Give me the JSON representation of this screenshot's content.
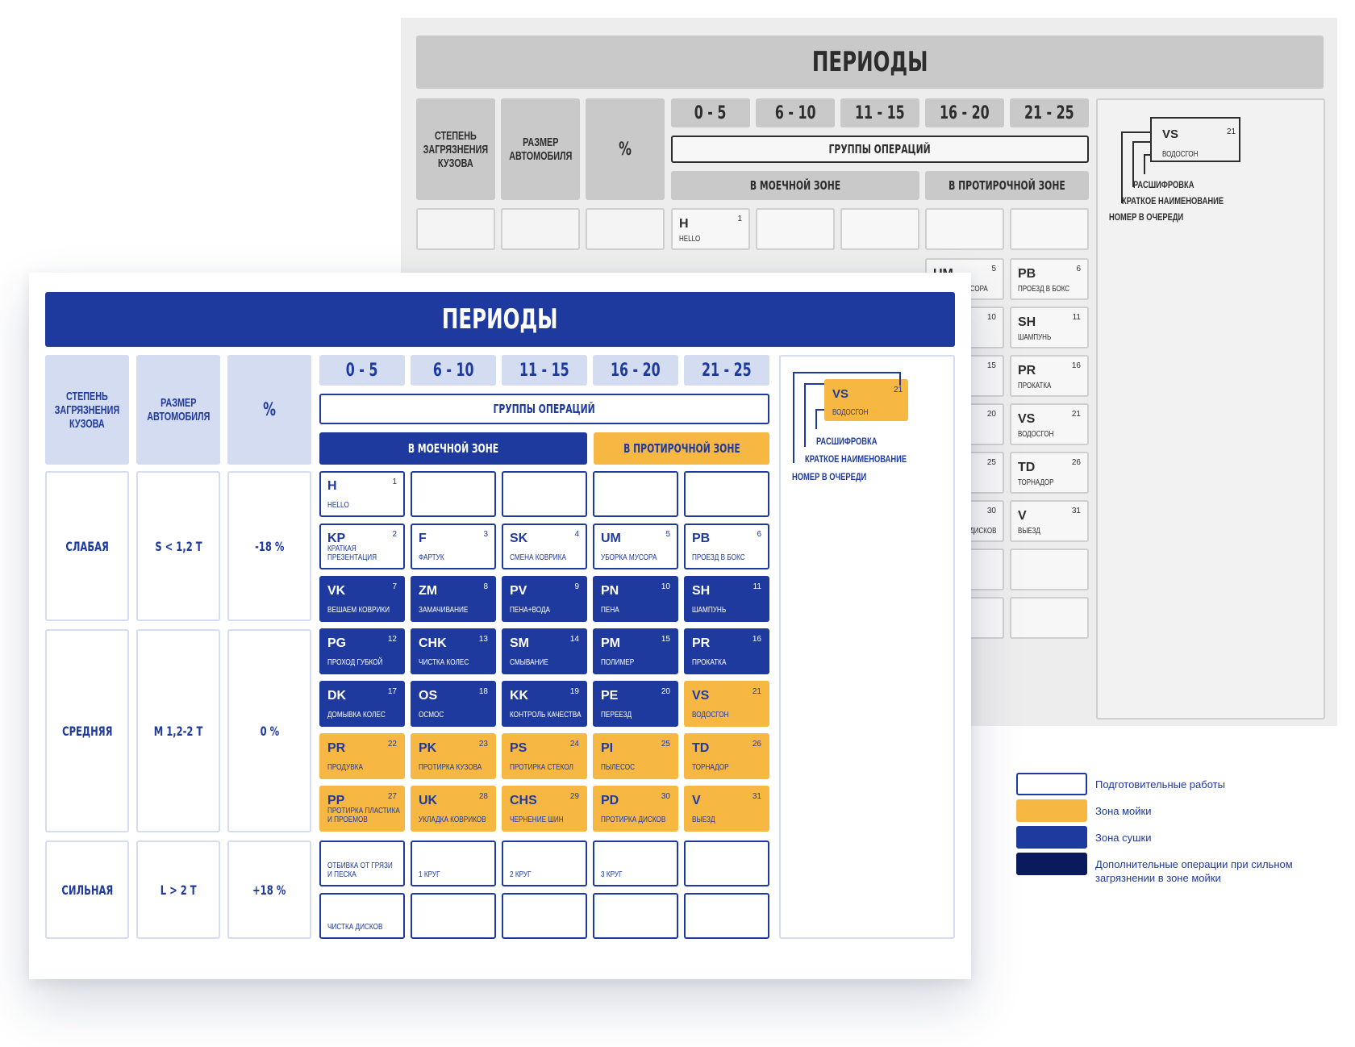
{
  "periods": [
    "0 - 5",
    "6 - 10",
    "11 - 15",
    "16 - 20",
    "21 - 25"
  ],
  "headers": {
    "title": "ПЕРИОДЫ",
    "degree": "СТЕПЕНЬ ЗАГРЯЗНЕНИЯ КУЗОВА",
    "size": "РАЗМЕР АВТОМОБИЛЯ",
    "percent": "%",
    "groups": "ГРУППЫ ОПЕРАЦИЙ",
    "wash_zone": "В МОЕЧНОЙ ЗОНЕ",
    "wipe_zone": "В ПРОТИРОЧНОЙ ЗОНЕ"
  },
  "rows": [
    {
      "degree": "СЛАБАЯ",
      "size": "S < 1,2 Т",
      "percent": "-18 %"
    },
    {
      "degree": "СРЕДНЯЯ",
      "size": "M 1,2-2 Т",
      "percent": "0 %"
    },
    {
      "degree": "СИЛЬНАЯ",
      "size": "L > 2 Т",
      "percent": "+18 %"
    }
  ],
  "operations": [
    {
      "code": "H",
      "num": "1",
      "name": "HELLO",
      "style": "white"
    },
    {
      "code": "",
      "num": "",
      "name": "",
      "style": "white"
    },
    {
      "code": "",
      "num": "",
      "name": "",
      "style": "white"
    },
    {
      "code": "",
      "num": "",
      "name": "",
      "style": "white"
    },
    {
      "code": "",
      "num": "",
      "name": "",
      "style": "white"
    },
    {
      "code": "KP",
      "num": "2",
      "name": "КРАТКАЯ\nПРЕЗЕНТАЦИЯ",
      "style": "white"
    },
    {
      "code": "F",
      "num": "3",
      "name": "ФАРТУК",
      "style": "white"
    },
    {
      "code": "SK",
      "num": "4",
      "name": "СМЕНА КОВРИКА",
      "style": "white"
    },
    {
      "code": "UM",
      "num": "5",
      "name": "УБОРКА МУСОРА",
      "style": "white"
    },
    {
      "code": "PB",
      "num": "6",
      "name": "ПРОЕЗД В БОКС",
      "style": "white"
    },
    {
      "code": "VK",
      "num": "7",
      "name": "ВЕШАЕМ КОВРИКИ",
      "style": "blue"
    },
    {
      "code": "ZM",
      "num": "8",
      "name": "ЗАМАЧИВАНИЕ",
      "style": "blue"
    },
    {
      "code": "PV",
      "num": "9",
      "name": "ПЕНА+ВОДА",
      "style": "blue"
    },
    {
      "code": "PN",
      "num": "10",
      "name": "ПЕНА",
      "style": "blue"
    },
    {
      "code": "SH",
      "num": "11",
      "name": "ШАМПУНЬ",
      "style": "blue"
    },
    {
      "code": "PG",
      "num": "12",
      "name": "ПРОХОД ГУБКОЙ",
      "style": "blue"
    },
    {
      "code": "CHK",
      "num": "13",
      "name": "ЧИСТКА КОЛЕС",
      "style": "blue"
    },
    {
      "code": "SM",
      "num": "14",
      "name": "СМЫВАНИЕ",
      "style": "blue"
    },
    {
      "code": "PM",
      "num": "15",
      "name": "ПОЛИМЕР",
      "style": "blue"
    },
    {
      "code": "PR",
      "num": "16",
      "name": "ПРОКАТКА",
      "style": "blue"
    },
    {
      "code": "DK",
      "num": "17",
      "name": "ДОМЫВКА КОЛЕС",
      "style": "blue"
    },
    {
      "code": "OS",
      "num": "18",
      "name": "ОСМОС",
      "style": "blue"
    },
    {
      "code": "KK",
      "num": "19",
      "name": "КОНТРОЛЬ КАЧЕСТВА",
      "style": "blue"
    },
    {
      "code": "PE",
      "num": "20",
      "name": "ПЕРЕЕЗД",
      "style": "blue"
    },
    {
      "code": "VS",
      "num": "21",
      "name": "ВОДОСГОН",
      "style": "yellow"
    },
    {
      "code": "PR",
      "num": "22",
      "name": "ПРОДУВКА",
      "style": "yellow"
    },
    {
      "code": "PK",
      "num": "23",
      "name": "ПРОТИРКА КУЗОВА",
      "style": "yellow"
    },
    {
      "code": "PS",
      "num": "24",
      "name": "ПРОТИРКА СТЕКОЛ",
      "style": "yellow"
    },
    {
      "code": "PI",
      "num": "25",
      "name": "ПЫЛЕСОС",
      "style": "yellow"
    },
    {
      "code": "TD",
      "num": "26",
      "name": "ТОРНАДОР",
      "style": "yellow"
    },
    {
      "code": "PP",
      "num": "27",
      "name": "ПРОТИРКА ПЛАСТИКА\nИ ПРОЕМОВ",
      "style": "yellow"
    },
    {
      "code": "UK",
      "num": "28",
      "name": "УКЛАДКА КОВРИКОВ",
      "style": "yellow"
    },
    {
      "code": "CHS",
      "num": "29",
      "name": "ЧЕРНЕНИЕ ШИН",
      "style": "yellow"
    },
    {
      "code": "PD",
      "num": "30",
      "name": "ПРОТИРКА ДИСКОВ",
      "style": "yellow"
    },
    {
      "code": "V",
      "num": "31",
      "name": "ВЫЕЗД",
      "style": "yellow"
    },
    {
      "code": "",
      "num": "",
      "name": "ОТБИВКА ОТ ГРЯЗИ\nИ ПЕСКА",
      "style": "white"
    },
    {
      "code": "",
      "num": "",
      "name": "1 КРУГ",
      "style": "white"
    },
    {
      "code": "",
      "num": "",
      "name": "2 КРУГ",
      "style": "white"
    },
    {
      "code": "",
      "num": "",
      "name": "3 КРУГ",
      "style": "white"
    },
    {
      "code": "",
      "num": "",
      "name": "",
      "style": "white"
    },
    {
      "code": "",
      "num": "",
      "name": "ЧИСТКА ДИСКОВ",
      "style": "white"
    },
    {
      "code": "",
      "num": "",
      "name": "",
      "style": "white"
    },
    {
      "code": "",
      "num": "",
      "name": "",
      "style": "white"
    },
    {
      "code": "",
      "num": "",
      "name": "",
      "style": "white"
    },
    {
      "code": "",
      "num": "",
      "name": "",
      "style": "white"
    }
  ],
  "back_sheet": {
    "first_cell": {
      "code": "H",
      "num": "1",
      "name": "HELLO"
    },
    "right_ops": [
      {
        "code": "UM",
        "num": "5",
        "name": "УБОРКА МУСОРА"
      },
      {
        "code": "PB",
        "num": "6",
        "name": "ПРОЕЗД В БОКС"
      },
      {
        "code": "PN",
        "num": "10",
        "name": "ПЕНА"
      },
      {
        "code": "SH",
        "num": "11",
        "name": "ШАМПУНЬ"
      },
      {
        "code": "PM",
        "num": "15",
        "name": "ПОЛИМЕР"
      },
      {
        "code": "PR",
        "num": "16",
        "name": "ПРОКАТКА"
      },
      {
        "code": "PE",
        "num": "20",
        "name": "ПЕРЕЕЗД"
      },
      {
        "code": "VS",
        "num": "21",
        "name": "ВОДОСГОН"
      },
      {
        "code": "PI",
        "num": "25",
        "name": "ПЫЛЕСОС"
      },
      {
        "code": "TD",
        "num": "26",
        "name": "ТОРНАДОР"
      },
      {
        "code": "PD",
        "num": "30",
        "name": "ПРОТИРКА ДИСКОВ"
      },
      {
        "code": "V",
        "num": "31",
        "name": "ВЫЕЗД"
      },
      {
        "code": "",
        "num": "",
        "name": "3 КРУГ"
      },
      {
        "code": "",
        "num": "",
        "name": ""
      },
      {
        "code": "",
        "num": "",
        "name": ""
      },
      {
        "code": "",
        "num": "",
        "name": ""
      }
    ]
  },
  "key_card": {
    "code": "VS",
    "num": "21",
    "name": "ВОДОСГОН",
    "label_decode": "РАСШИФРОВКА",
    "label_short": "КРАТКОЕ НАИМЕНОВАНИЕ",
    "label_queue": "НОМЕР В ОЧЕРЕДИ"
  },
  "legend": [
    {
      "label": "Подготовительные работы",
      "color": "#ffffff",
      "border": "#1f3a9e"
    },
    {
      "label": "Зона мойки",
      "color": "#f7b843",
      "border": "#f7b843"
    },
    {
      "label": "Зона сушки",
      "color": "#1f3a9e",
      "border": "#1f3a9e"
    },
    {
      "label": "Дополнительные операции при сильном загрязнении в зоне мойки",
      "color": "#0b1a5c",
      "border": "#0b1a5c"
    }
  ],
  "colors": {
    "blue": "#1f3a9e",
    "light_blue": "#d3dcf0",
    "yellow": "#f7b843",
    "navy": "#0b1a5c",
    "grey": "#c9c9c9"
  }
}
